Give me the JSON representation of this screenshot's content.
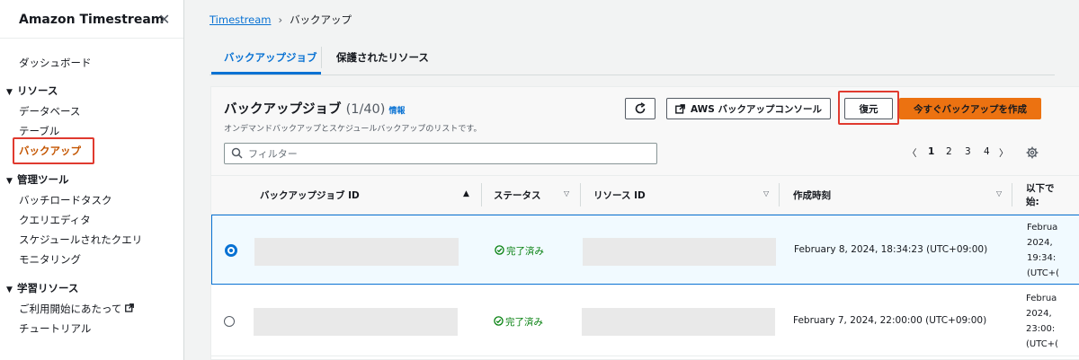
{
  "sidebar": {
    "title": "Amazon Timestream",
    "close_glyph": "✕",
    "dashboard": "ダッシュボード",
    "resources": {
      "label": "リソース",
      "items": [
        "データベース",
        "テーブル",
        "バックアップ"
      ]
    },
    "management": {
      "label": "管理ツール",
      "items": [
        "バッチロードタスク",
        "クエリエディタ",
        "スケジュールされたクエリ",
        "モニタリング"
      ]
    },
    "learning": {
      "label": "学習リソース",
      "items": [
        "ご利用開始にあたって",
        "チュートリアル"
      ]
    }
  },
  "breadcrumb": {
    "root": "Timestream",
    "current": "バックアップ"
  },
  "tabs": [
    "バックアップジョブ",
    "保護されたリソース"
  ],
  "panel": {
    "title": "バックアップジョブ",
    "count": "(1/40)",
    "info": "情報",
    "description": "オンデマンドバックアップとスケジュールバックアップのリストです。",
    "refresh_icon": "refresh-icon",
    "console_button": "AWS バックアップコンソール",
    "restore_button": "復元",
    "create_button": "今すぐバックアップを作成",
    "filter_placeholder": "フィルター"
  },
  "pagination": {
    "prev": "〈",
    "pages": [
      "1",
      "2",
      "3",
      "4"
    ],
    "current": "1",
    "next": "〉"
  },
  "table": {
    "columns": [
      "バックアップジョブ ID",
      "ステータス",
      "リソース ID",
      "作成時刻"
    ],
    "truncated_column": [
      "以下で",
      "始:"
    ],
    "rows": [
      {
        "selected": true,
        "status": "完了済み",
        "created": "February 8, 2024, 18:34:23 (UTC+09:00)",
        "cut": [
          "Februa",
          "2024,",
          "19:34:",
          "(UTC+("
        ]
      },
      {
        "selected": false,
        "status": "完了済み",
        "created": "February 7, 2024, 22:00:00 (UTC+09:00)",
        "cut": [
          "Februa",
          "2024,",
          "23:00:",
          "(UTC+("
        ]
      }
    ]
  },
  "colors": {
    "accent": "#0972d3",
    "primary_button": "#ec7211",
    "success": "#037f0c",
    "highlight_box": "#e03a2f",
    "active_nav": "#c45500"
  }
}
